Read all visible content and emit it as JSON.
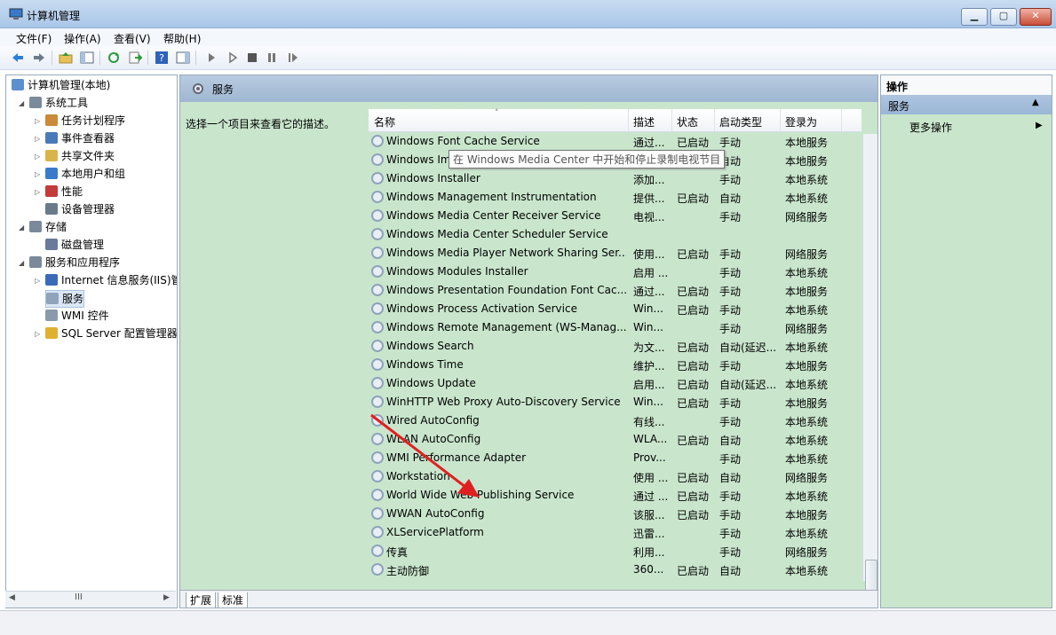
{
  "window": {
    "title": "计算机管理"
  },
  "menu": [
    "文件(F)",
    "操作(A)",
    "查看(V)",
    "帮助(H)"
  ],
  "toolbar_icons": [
    "back-arrow-icon",
    "forward-arrow-icon",
    "up-folder-icon",
    "show-hide-tree-icon",
    "refresh-icon",
    "export-icon",
    "help-icon",
    "show-hide-action-icon",
    "play-icon",
    "play-outline-icon",
    "stop-icon",
    "pause-icon",
    "restart-icon"
  ],
  "tree": {
    "root": "计算机管理(本地)",
    "items": [
      {
        "label": "系统工具",
        "level": 1,
        "expand": "open"
      },
      {
        "label": "任务计划程序",
        "level": 2,
        "expand": "closed"
      },
      {
        "label": "事件查看器",
        "level": 2,
        "expand": "closed"
      },
      {
        "label": "共享文件夹",
        "level": 2,
        "expand": "closed"
      },
      {
        "label": "本地用户和组",
        "level": 2,
        "expand": "closed"
      },
      {
        "label": "性能",
        "level": 2,
        "expand": "closed"
      },
      {
        "label": "设备管理器",
        "level": 2,
        "expand": "none"
      },
      {
        "label": "存储",
        "level": 1,
        "expand": "open"
      },
      {
        "label": "磁盘管理",
        "level": 2,
        "expand": "none"
      },
      {
        "label": "服务和应用程序",
        "level": 1,
        "expand": "open"
      },
      {
        "label": "Internet 信息服务(IIS)管",
        "level": 2,
        "expand": "closed"
      },
      {
        "label": "服务",
        "level": 2,
        "expand": "none",
        "selected": true
      },
      {
        "label": "WMI 控件",
        "level": 2,
        "expand": "none"
      },
      {
        "label": "SQL Server 配置管理器",
        "level": 2,
        "expand": "closed"
      }
    ]
  },
  "center": {
    "title": "服务",
    "description_prompt": "选择一个项目来查看它的描述。",
    "columns": [
      "名称",
      "描述",
      "状态",
      "启动类型",
      "登录为"
    ],
    "rows": [
      {
        "name": "Windows Font Cache Service",
        "desc": "通过...",
        "status": "已启动",
        "startup": "手动",
        "logon": "本地服务"
      },
      {
        "name": "Windows Image Acquisition (WIA)",
        "desc": "为扫...",
        "status": "已启动",
        "startup": "自动",
        "logon": "本地服务"
      },
      {
        "name": "Windows Installer",
        "desc": "添加...",
        "status": "",
        "startup": "手动",
        "logon": "本地系统"
      },
      {
        "name": "Windows Management Instrumentation",
        "desc": "提供...",
        "status": "已启动",
        "startup": "自动",
        "logon": "本地系统"
      },
      {
        "name": "Windows Media Center Receiver Service",
        "desc": "电视...",
        "status": "",
        "startup": "手动",
        "logon": "网络服务"
      },
      {
        "name": "Windows Media Center Scheduler Service",
        "desc": "",
        "status": "",
        "startup": "",
        "logon": ""
      },
      {
        "name": "Windows Media Player Network Sharing Ser...",
        "desc": "使用...",
        "status": "已启动",
        "startup": "手动",
        "logon": "网络服务"
      },
      {
        "name": "Windows Modules Installer",
        "desc": "启用 ...",
        "status": "",
        "startup": "手动",
        "logon": "本地系统"
      },
      {
        "name": "Windows Presentation Foundation Font Cac...",
        "desc": "通过...",
        "status": "已启动",
        "startup": "手动",
        "logon": "本地服务"
      },
      {
        "name": "Windows Process Activation Service",
        "desc": "Win...",
        "status": "已启动",
        "startup": "手动",
        "logon": "本地系统"
      },
      {
        "name": "Windows Remote Management (WS-Manag...",
        "desc": "Win...",
        "status": "",
        "startup": "手动",
        "logon": "网络服务"
      },
      {
        "name": "Windows Search",
        "desc": "为文...",
        "status": "已启动",
        "startup": "自动(延迟...",
        "logon": "本地系统"
      },
      {
        "name": "Windows Time",
        "desc": "维护...",
        "status": "已启动",
        "startup": "手动",
        "logon": "本地服务"
      },
      {
        "name": "Windows Update",
        "desc": "启用...",
        "status": "已启动",
        "startup": "自动(延迟...",
        "logon": "本地系统"
      },
      {
        "name": "WinHTTP Web Proxy Auto-Discovery Service",
        "desc": "Win...",
        "status": "已启动",
        "startup": "手动",
        "logon": "本地服务"
      },
      {
        "name": "Wired AutoConfig",
        "desc": "有线...",
        "status": "",
        "startup": "手动",
        "logon": "本地系统"
      },
      {
        "name": "WLAN AutoConfig",
        "desc": "WLA...",
        "status": "已启动",
        "startup": "自动",
        "logon": "本地系统"
      },
      {
        "name": "WMI Performance Adapter",
        "desc": "Prov...",
        "status": "",
        "startup": "手动",
        "logon": "本地系统"
      },
      {
        "name": "Workstation",
        "desc": "使用 ...",
        "status": "已启动",
        "startup": "自动",
        "logon": "网络服务"
      },
      {
        "name": "World Wide Web Publishing Service",
        "desc": "通过 ...",
        "status": "已启动",
        "startup": "手动",
        "logon": "本地系统"
      },
      {
        "name": "WWAN AutoConfig",
        "desc": "该服...",
        "status": "已启动",
        "startup": "手动",
        "logon": "本地服务"
      },
      {
        "name": "XLServicePlatform",
        "desc": "迅雷...",
        "status": "",
        "startup": "手动",
        "logon": "本地系统"
      },
      {
        "name": "传真",
        "desc": "利用...",
        "status": "",
        "startup": "手动",
        "logon": "网络服务"
      },
      {
        "name": "主动防御",
        "desc": "360...",
        "status": "已启动",
        "startup": "自动",
        "logon": "本地系统"
      }
    ],
    "tooltip": "在 Windows Media Center 中开始和停止录制电视节目",
    "tabs": [
      "扩展",
      "标准"
    ]
  },
  "actions": {
    "header": "操作",
    "section": "服务",
    "more": "更多操作"
  },
  "colors": {
    "panel_green": "#c9e6cd",
    "header_blue": "#9fb7d2",
    "arrow_red": "#e02020"
  }
}
